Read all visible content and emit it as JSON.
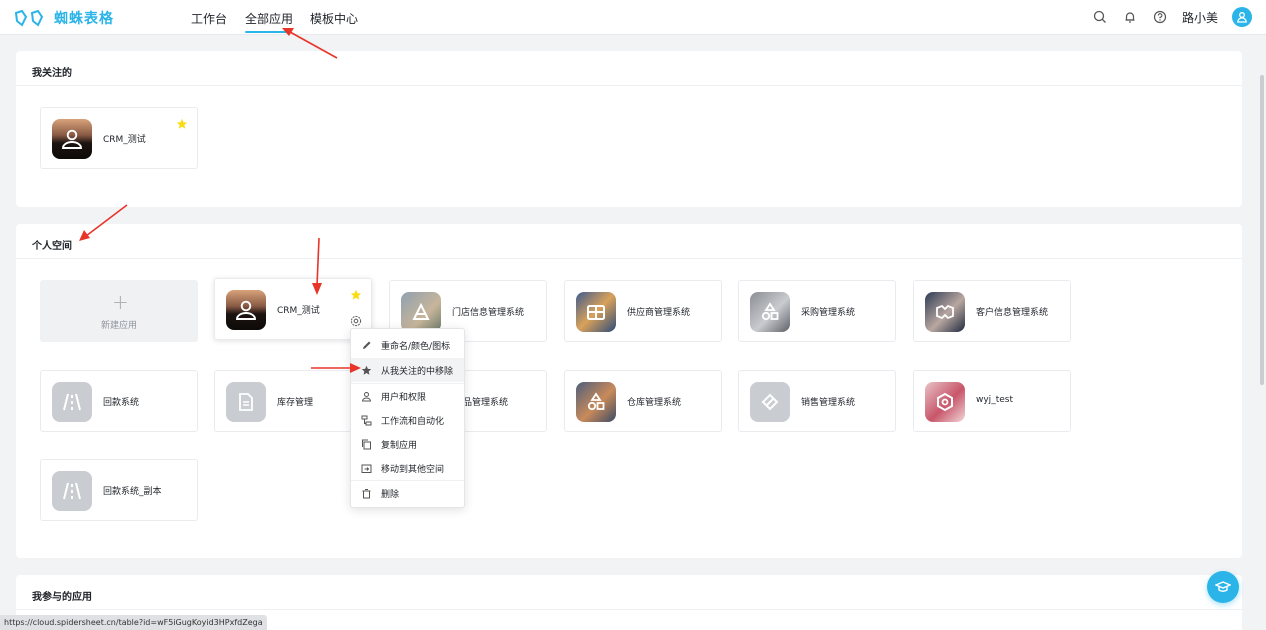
{
  "brand": {
    "name": "蜘蛛表格",
    "color": "#2bb4e8"
  },
  "nav": [
    {
      "label": "工作台",
      "active": false
    },
    {
      "label": "全部应用",
      "active": true
    },
    {
      "label": "模板中心",
      "active": false
    }
  ],
  "header": {
    "icons": [
      "search-icon",
      "bell-icon",
      "help-icon"
    ],
    "user_name": "路小美"
  },
  "sections": {
    "favorites": {
      "title": "我关注的",
      "apps": [
        {
          "label": "CRM_测试",
          "icon": "user-icon",
          "starred": true
        }
      ]
    },
    "personal": {
      "title": "个人空间",
      "new_app_label": "新建应用",
      "apps": [
        {
          "label": "CRM_测试",
          "icon": "user-icon",
          "starred": true
        },
        {
          "label": "门店信息管理系统",
          "icon": "store-icon"
        },
        {
          "label": "供应商管理系统",
          "icon": "supplier-icon"
        },
        {
          "label": "采购管理系统",
          "icon": "purchase-icon"
        },
        {
          "label": "客户信息管理系统",
          "icon": "customer-icon"
        },
        {
          "label": "回款系统",
          "icon": "road-icon"
        },
        {
          "label": "库存管理",
          "icon": "document-icon"
        },
        {
          "label": "品管理系统",
          "icon": "product-icon"
        },
        {
          "label": "仓库管理系统",
          "icon": "warehouse-icon"
        },
        {
          "label": "销售管理系统",
          "icon": "tag-icon"
        },
        {
          "label": "wyj_test",
          "icon": "hexagon-icon"
        },
        {
          "label": "回款系统_副本",
          "icon": "road-icon"
        }
      ]
    },
    "participating": {
      "title": "我参与的应用"
    }
  },
  "context_menu": {
    "items": [
      {
        "label": "重命名/颜色/图标",
        "icon": "pencil-icon"
      },
      {
        "label": "从我关注的中移除",
        "icon": "star-icon"
      },
      {
        "label": "用户和权限",
        "icon": "users-icon"
      },
      {
        "label": "工作流和自动化",
        "icon": "workflow-icon"
      },
      {
        "label": "复制应用",
        "icon": "copy-icon"
      },
      {
        "label": "移动到其他空间",
        "icon": "move-icon"
      },
      {
        "label": "删除",
        "icon": "trash-icon"
      }
    ]
  },
  "status_bar": {
    "url": "https://cloud.spidersheet.cn/table?id=wF5iGugKoyid3HPxfdZega"
  },
  "colors": {
    "accent": "#2bb4e8",
    "star": "#fadb14",
    "arrow": "#e8352a"
  }
}
